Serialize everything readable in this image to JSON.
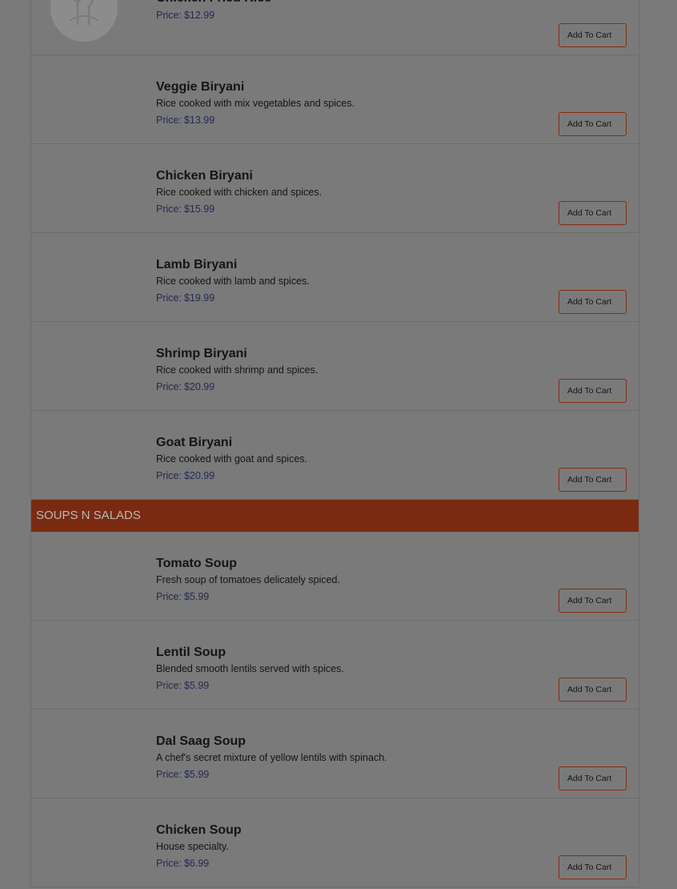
{
  "labels": {
    "price_prefix": "Price:",
    "add_to_cart": "Add To Cart"
  },
  "biryani_items": [
    {
      "name": "Chicken Fried Rice",
      "description": "",
      "price": "$12.99"
    },
    {
      "name": "Veggie Biryani",
      "description": "Rice cooked with mix vegetables and spices.",
      "price": "$13.99"
    },
    {
      "name": "Chicken Biryani",
      "description": "Rice cooked with chicken and spices.",
      "price": "$15.99"
    },
    {
      "name": "Lamb Biryani",
      "description": "Rice cooked with lamb and spices.",
      "price": "$19.99"
    },
    {
      "name": "Shrimp Biryani",
      "description": "Rice cooked with shrimp and spices.",
      "price": "$20.99"
    },
    {
      "name": "Goat Biryani",
      "description": "Rice cooked with goat and spices.",
      "price": "$20.99"
    }
  ],
  "soups_section": {
    "title": "SOUPS N SALADS",
    "items": [
      {
        "name": "Tomato Soup",
        "description": "Fresh soup of tomatoes delicately spiced.",
        "price": "$5.99"
      },
      {
        "name": "Lentil Soup",
        "description": "Blended smooth lentils served with spices.",
        "price": "$5.99"
      },
      {
        "name": "Dal Saag Soup",
        "description": "A chef's secret mixture of yellow lentils with spinach.",
        "price": "$5.99"
      },
      {
        "name": "Chicken Soup",
        "description": "House specialty.",
        "price": "$6.99"
      }
    ]
  },
  "colors": {
    "section_header_bg": "#7a2a10",
    "price_text": "#232a52",
    "overlay_bg": "#7a7a7a"
  },
  "icons": {
    "first_item_thumbnail": "restaurant-logo-icon"
  }
}
